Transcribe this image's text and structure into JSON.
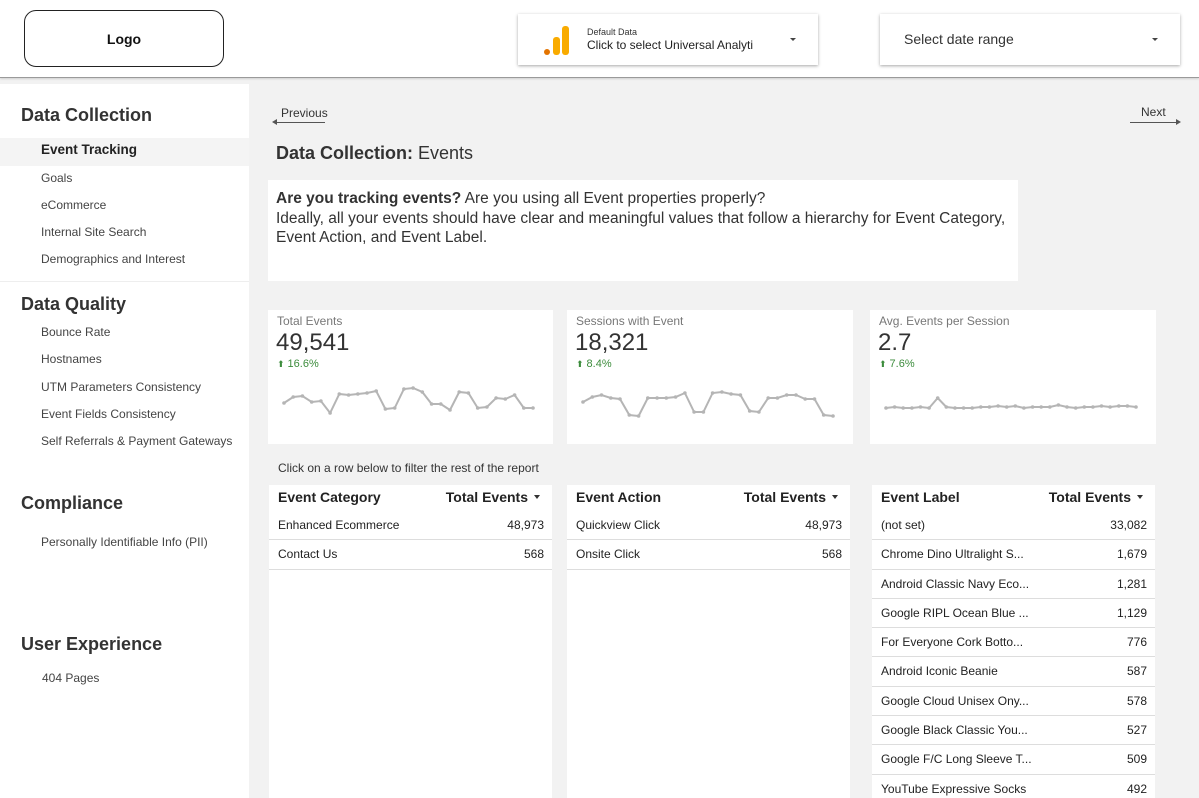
{
  "header": {
    "logo_label": "Logo",
    "data_source": {
      "small_label": "Default Data",
      "main_label": "Click to select Universal Analyti",
      "icon": "google-analytics-icon"
    },
    "date_range": {
      "label": "Select date range"
    }
  },
  "sidebar": {
    "sections": [
      {
        "title": "Data Collection",
        "items": [
          "Event Tracking",
          "Goals",
          "eCommerce",
          "Internal Site Search",
          "Demographics and Interest"
        ]
      },
      {
        "title": "Data Quality",
        "items": [
          "Bounce Rate",
          "Hostnames",
          "UTM Parameters Consistency",
          "Event Fields Consistency",
          "Self Referrals & Payment Gateways"
        ]
      },
      {
        "title": "Compliance",
        "items": [
          "Personally Identifiable Info (PII)"
        ]
      },
      {
        "title": "User Experience",
        "items": [
          "404 Pages"
        ]
      }
    ],
    "active_item": "Event Tracking"
  },
  "main": {
    "prev_label": "Previous",
    "next_label": "Next",
    "title_bold": "Data Collection:",
    "title_rest": " Events",
    "info": {
      "bold": "Are you tracking events?",
      "line1": " Are you using all Event properties properly?",
      "line2": "Ideally, all your events should have clear and meaningful values that follow a hierarchy for Event Category, Event Action, and Event Label."
    },
    "kpis": [
      {
        "label": "Total Events",
        "value": "49,541",
        "delta": "16.6%",
        "trend": [
          18,
          12,
          11,
          17,
          16,
          28,
          9,
          10,
          9,
          8,
          6,
          24,
          23,
          4,
          3,
          7,
          19,
          19,
          25,
          7,
          8,
          23,
          22,
          13,
          14,
          10,
          23,
          23
        ]
      },
      {
        "label": "Sessions with Event",
        "value": "18,321",
        "delta": "8.4%",
        "trend": [
          17,
          12,
          10,
          13,
          14,
          30,
          31,
          13,
          13,
          13,
          12,
          8,
          27,
          27,
          8,
          7,
          9,
          10,
          26,
          27,
          13,
          13,
          10,
          10,
          14,
          14,
          30,
          31
        ]
      },
      {
        "label": "Avg. Events per Session",
        "value": "2.7",
        "delta": "7.6%",
        "trend": [
          23,
          22,
          23,
          23,
          22,
          23,
          13,
          22,
          23,
          23,
          23,
          22,
          22,
          21,
          22,
          21,
          23,
          22,
          22,
          22,
          20,
          22,
          23,
          22,
          22,
          21,
          22,
          21,
          21,
          22
        ]
      }
    ],
    "hint": "Click on a row below to filter the rest of the report"
  },
  "tables": [
    {
      "col1": "Event Category",
      "col2": "Total Events",
      "rows": [
        [
          "Enhanced Ecommerce",
          "48,973"
        ],
        [
          "Contact Us",
          "568"
        ]
      ]
    },
    {
      "col1": "Event Action",
      "col2": "Total Events",
      "rows": [
        [
          "Quickview Click",
          "48,973"
        ],
        [
          "Onsite Click",
          "568"
        ]
      ]
    },
    {
      "col1": "Event Label",
      "col2": "Total Events",
      "rows": [
        [
          "(not set)",
          "33,082"
        ],
        [
          "Chrome Dino Ultralight S...",
          "1,679"
        ],
        [
          "Android Classic Navy Eco...",
          "1,281"
        ],
        [
          "Google RIPL Ocean Blue ...",
          "1,129"
        ],
        [
          "For Everyone Cork Botto...",
          "776"
        ],
        [
          "Android Iconic Beanie",
          "587"
        ],
        [
          "Google Cloud Unisex Ony...",
          "578"
        ],
        [
          "Google Black Classic You...",
          "527"
        ],
        [
          "Google F/C Long Sleeve T...",
          "509"
        ],
        [
          "YouTube Expressive Socks",
          "492"
        ]
      ]
    }
  ],
  "colors": {
    "delta_green": "#3c8c3c",
    "spark_gray": "#b5b5b5",
    "ga_orange": "#f9ab00",
    "ga_dark_orange": "#e37400"
  }
}
